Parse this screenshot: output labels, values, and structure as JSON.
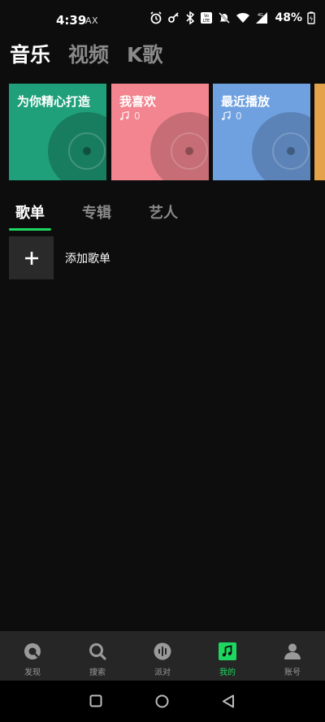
{
  "status_bar": {
    "time": "4:39",
    "carrier": "AX",
    "battery": "48%",
    "icons": [
      "alarm-icon",
      "key-icon",
      "bluetooth-icon",
      "volte-icon",
      "mute-icon",
      "wifi-icon",
      "signal-icon",
      "battery-icon"
    ]
  },
  "top_tabs": [
    {
      "label": "音乐"
    },
    {
      "label": "视频"
    },
    {
      "label": "K歌"
    }
  ],
  "cards": [
    {
      "title": "为你精心打造",
      "count": "",
      "color": "#1fa07a"
    },
    {
      "title": "我喜欢",
      "count": "0",
      "color": "#f2858f"
    },
    {
      "title": "最近播放",
      "count": "0",
      "color": "#6fa0e0"
    },
    {
      "title": "",
      "count": "",
      "color": "#e4a24a"
    }
  ],
  "sub_tabs": [
    {
      "label": "歌单"
    },
    {
      "label": "专辑"
    },
    {
      "label": "艺人"
    }
  ],
  "add_playlist": {
    "label": "添加歌单",
    "icon": "plus-icon"
  },
  "bottom_nav": [
    {
      "label": "发现",
      "icon": "discover-icon"
    },
    {
      "label": "搜索",
      "icon": "search-icon"
    },
    {
      "label": "派对",
      "icon": "party-icon"
    },
    {
      "label": "我的",
      "icon": "my-music-icon"
    },
    {
      "label": "账号",
      "icon": "account-icon"
    }
  ],
  "colors": {
    "accent": "#1ed760",
    "background": "#0d0d0d",
    "nav_bg": "#262626"
  }
}
